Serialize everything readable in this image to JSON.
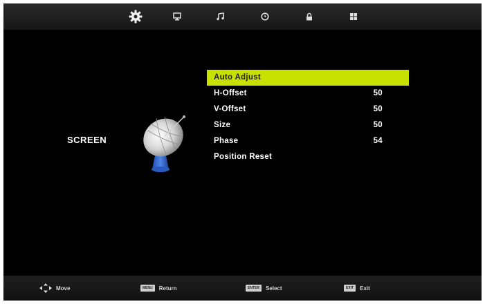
{
  "tabs": [
    {
      "icon": "gear-icon",
      "active": true
    },
    {
      "icon": "monitor-icon",
      "active": false
    },
    {
      "icon": "music-icon",
      "active": false
    },
    {
      "icon": "clock-icon",
      "active": false
    },
    {
      "icon": "lock-icon",
      "active": false
    },
    {
      "icon": "grid-icon",
      "active": false
    }
  ],
  "section_label": "SCREEN",
  "menu": {
    "items": [
      {
        "label": "Auto Adjust",
        "value": "",
        "selected": true
      },
      {
        "label": "H-Offset",
        "value": "50",
        "selected": false
      },
      {
        "label": "V-Offset",
        "value": "50",
        "selected": false
      },
      {
        "label": "Size",
        "value": "50",
        "selected": false
      },
      {
        "label": "Phase",
        "value": "54",
        "selected": false
      },
      {
        "label": "Position Reset",
        "value": "",
        "selected": false
      }
    ]
  },
  "footer": {
    "move": {
      "label": "Move"
    },
    "return": {
      "key": "MENU",
      "label": "Return"
    },
    "select": {
      "key": "ENTER",
      "label": "Select"
    },
    "exit": {
      "key": "EXIT",
      "label": "Exit"
    }
  },
  "colors": {
    "highlight": "#c8e000",
    "background": "#000000",
    "text": "#ffffff"
  }
}
